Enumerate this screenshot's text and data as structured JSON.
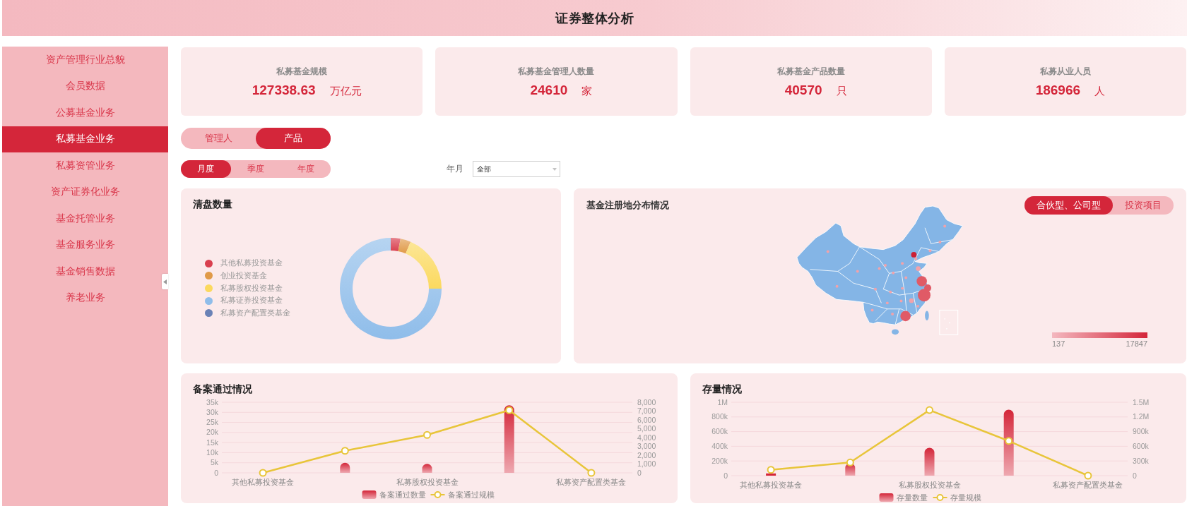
{
  "header": {
    "title": "证券整体分析"
  },
  "sidebar": {
    "items": [
      {
        "label": "资产管理行业总貌",
        "selected": false
      },
      {
        "label": "会员数据",
        "selected": false
      },
      {
        "label": "公募基金业务",
        "selected": false
      },
      {
        "label": "私募基金业务",
        "selected": true
      },
      {
        "label": "私募资管业务",
        "selected": false
      },
      {
        "label": "资产证券化业务",
        "selected": false
      },
      {
        "label": "基金托管业务",
        "selected": false
      },
      {
        "label": "基金服务业务",
        "selected": false
      },
      {
        "label": "基金销售数据",
        "selected": false
      },
      {
        "label": "养老业务",
        "selected": false
      }
    ]
  },
  "kpis": [
    {
      "label": "私募基金规模",
      "value": "127338.63",
      "unit": "万亿元"
    },
    {
      "label": "私募基金管理人数量",
      "value": "24610",
      "unit": "家"
    },
    {
      "label": "私募基金产品数量",
      "value": "40570",
      "unit": "只"
    },
    {
      "label": "私募从业人员",
      "value": "186966",
      "unit": "人"
    }
  ],
  "view_tabs": [
    {
      "label": "管理人",
      "selected": false
    },
    {
      "label": "产品",
      "selected": true
    }
  ],
  "period_tabs": [
    {
      "label": "月度",
      "selected": true
    },
    {
      "label": "季度",
      "selected": false
    },
    {
      "label": "年度",
      "selected": false
    }
  ],
  "filter": {
    "label": "年月",
    "value": "全部"
  },
  "liquidation_card": {
    "title": "清盘数量",
    "legend": [
      {
        "label": "其他私募投资基金",
        "color": "#d9404f"
      },
      {
        "label": "创业投资基金",
        "color": "#e09a48"
      },
      {
        "label": "私募股权投资基金",
        "color": "#fbd95e"
      },
      {
        "label": "私募证券投资基金",
        "color": "#8fbdea"
      },
      {
        "label": "私募资产配置类基金",
        "color": "#6a82b6"
      }
    ]
  },
  "map_card": {
    "title": "基金注册地分布情况",
    "tabs": [
      {
        "label": "合伙型、公司型",
        "selected": true
      },
      {
        "label": "投资项目",
        "selected": false
      }
    ],
    "scale": {
      "min": "137",
      "max": "17847"
    }
  },
  "bottom_charts": [
    {
      "chart_data": {
        "type": "bar",
        "title": "备案通过情况",
        "categories": [
          "其他私募投资基金",
          null,
          "私募股权投资基金",
          null,
          "私募资产配置类基金"
        ],
        "grid": true,
        "legend": "bottom",
        "series": [
          {
            "name": "备案通过数量",
            "type": "bar",
            "color": "#d42639",
            "values": [
              0,
              5000,
              4500,
              33500,
              0
            ]
          },
          {
            "name": "备案通过规模",
            "type": "line",
            "axis": "y2",
            "marker": "circle",
            "color": "#e8c53a",
            "values": [
              0,
              2500,
              4300,
              7100,
              0
            ]
          }
        ],
        "ylim": [
          0,
          35000
        ],
        "yticks": [
          {
            "value": 0,
            "label": "0"
          },
          {
            "value": 5000,
            "label": "5k"
          },
          {
            "value": 10000,
            "label": "10k"
          },
          {
            "value": 15000,
            "label": "15k"
          },
          {
            "value": 20000,
            "label": "20k"
          },
          {
            "value": 25000,
            "label": "25k"
          },
          {
            "value": 30000,
            "label": "30k"
          },
          {
            "value": 35000,
            "label": "35k"
          }
        ],
        "y2lim": [
          0,
          8000
        ],
        "y2ticks": [
          {
            "value": 0,
            "label": "0"
          },
          {
            "value": 1000,
            "label": "1,000"
          },
          {
            "value": 2000,
            "label": "2,000"
          },
          {
            "value": 3000,
            "label": "3,000"
          },
          {
            "value": 4000,
            "label": "4,000"
          },
          {
            "value": 5000,
            "label": "5,000"
          },
          {
            "value": 6000,
            "label": "6,000"
          },
          {
            "value": 7000,
            "label": "7,000"
          },
          {
            "value": 8000,
            "label": "8,000"
          }
        ]
      }
    },
    {
      "chart_data": {
        "type": "bar",
        "title": "存量情况",
        "categories": [
          "其他私募投资基金",
          null,
          "私募股权投资基金",
          null,
          "私募资产配置类基金"
        ],
        "grid": true,
        "legend": "bottom",
        "series": [
          {
            "name": "存量数量",
            "type": "bar",
            "color": "#d42639",
            "values": [
              30000,
              170000,
              380000,
              900000,
              0
            ]
          },
          {
            "name": "存量规模",
            "type": "line",
            "axis": "y2",
            "marker": "circle",
            "color": "#e8c53a",
            "values": [
              120000,
              270000,
              1340000,
              710000,
              0
            ]
          }
        ],
        "ylim": [
          0,
          1000000
        ],
        "yticks": [
          {
            "value": 0,
            "label": "0"
          },
          {
            "value": 200000,
            "label": "200k"
          },
          {
            "value": 400000,
            "label": "400k"
          },
          {
            "value": 600000,
            "label": "600k"
          },
          {
            "value": 800000,
            "label": "800k"
          },
          {
            "value": 1000000,
            "label": "1M"
          }
        ],
        "y2lim": [
          0,
          1500000
        ],
        "y2ticks": [
          {
            "value": 0,
            "label": "0"
          },
          {
            "value": 300000,
            "label": "300k"
          },
          {
            "value": 600000,
            "label": "600k"
          },
          {
            "value": 900000,
            "label": "900k"
          },
          {
            "value": 1200000,
            "label": "1.2M"
          },
          {
            "value": 1500000,
            "label": "1.5M"
          }
        ]
      }
    }
  ]
}
